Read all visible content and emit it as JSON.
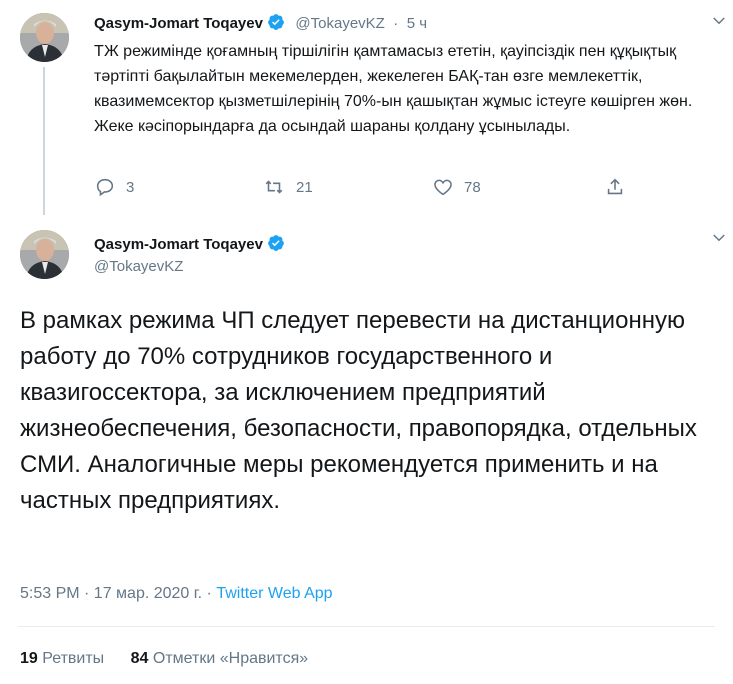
{
  "reply_tweet": {
    "author_name": "Qasym-Jomart Toqayev",
    "handle": "@TokayevKZ",
    "separator": "·",
    "time": "5 ч",
    "text": "ТЖ режимінде қоғамның тіршілігін қамтамасыз ететін, қауіпсіздік пен құқықтық тәртіпті бақылайтын мекемелерден, жекелеген БАҚ-тан өзге мемлекеттік, квазимемсектор қызметшілерінің 70%-ын қашықтан жұмыс істеуге көшірген жөн. Жеке кәсіпорындарға да осындай шараны қолдану ұсынылады.",
    "actions": {
      "replies": "3",
      "retweets": "21",
      "likes": "78"
    }
  },
  "main_tweet": {
    "author_name": "Qasym-Jomart Toqayev",
    "handle": "@TokayevKZ",
    "text": "В рамках режима ЧП следует перевести на дистанционную работу до 70% сотрудников государственного и квазигоссектора, за исключением предприятий жизнеобеспечения, безопасности, правопорядка, отдельных СМИ. Аналогичные меры рекомендуется применить и на частных предприятиях.",
    "timestamp": "5:53 PM · 17 мар. 2020 г. ·",
    "source": "Twitter Web App",
    "stats": {
      "retweets_count": "19",
      "retweets_label": "Ретвиты",
      "likes_count": "84",
      "likes_label": "Отметки «Нравится»"
    }
  },
  "colors": {
    "accent": "#1da1f2",
    "muted": "#657786",
    "text": "#14171a",
    "border": "#e6ecf0"
  },
  "icons": [
    "verified-badge-icon",
    "chevron-down-icon",
    "reply-icon",
    "retweet-icon",
    "like-icon",
    "share-icon"
  ]
}
